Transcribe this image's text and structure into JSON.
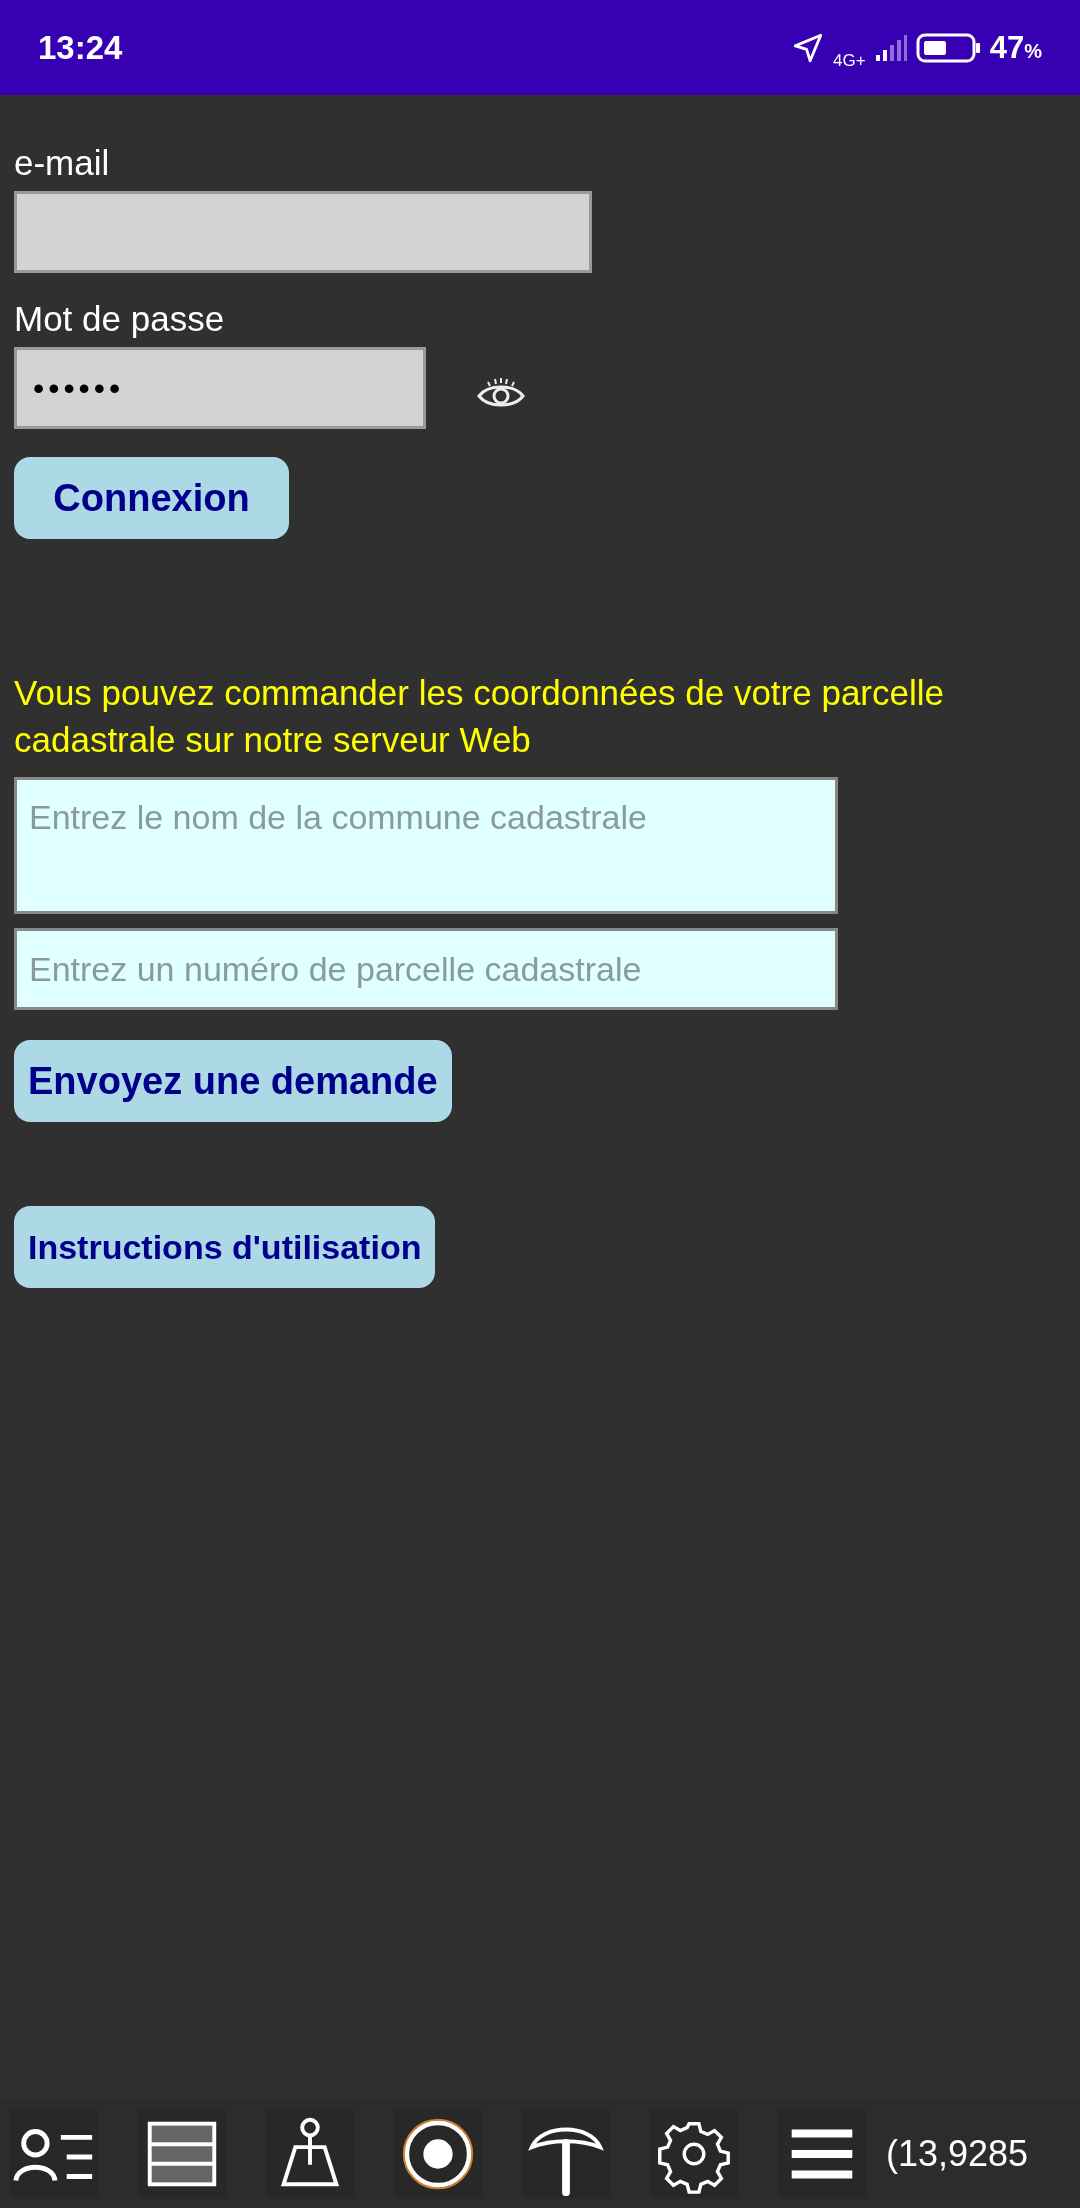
{
  "status_bar": {
    "time": "13:24",
    "network": "4G+",
    "battery": "47",
    "battery_unit": "%"
  },
  "login": {
    "email_label": "e-mail",
    "password_label": "Mot de passe",
    "password_value": "••••••",
    "submit": "Connexion"
  },
  "order": {
    "intro": "Vous pouvez commander les coordonnées de votre parcelle cadastrale sur notre serveur Web",
    "commune": {
      "placeholder": "Entrez le nom de la commune cadastrale"
    },
    "parcel": {
      "placeholder": "Entrez un numéro de parcelle cadastrale"
    },
    "send": "Envoyez une demande"
  },
  "help_button": "Instructions d'utilisation",
  "toolbar": {
    "items": [
      {
        "kind": "contacts"
      },
      {
        "kind": "layers"
      },
      {
        "kind": "tripod"
      },
      {
        "kind": "target"
      },
      {
        "kind": "antenna"
      },
      {
        "kind": "settings"
      },
      {
        "kind": "menu"
      }
    ],
    "coordinate": "(13,9285"
  }
}
